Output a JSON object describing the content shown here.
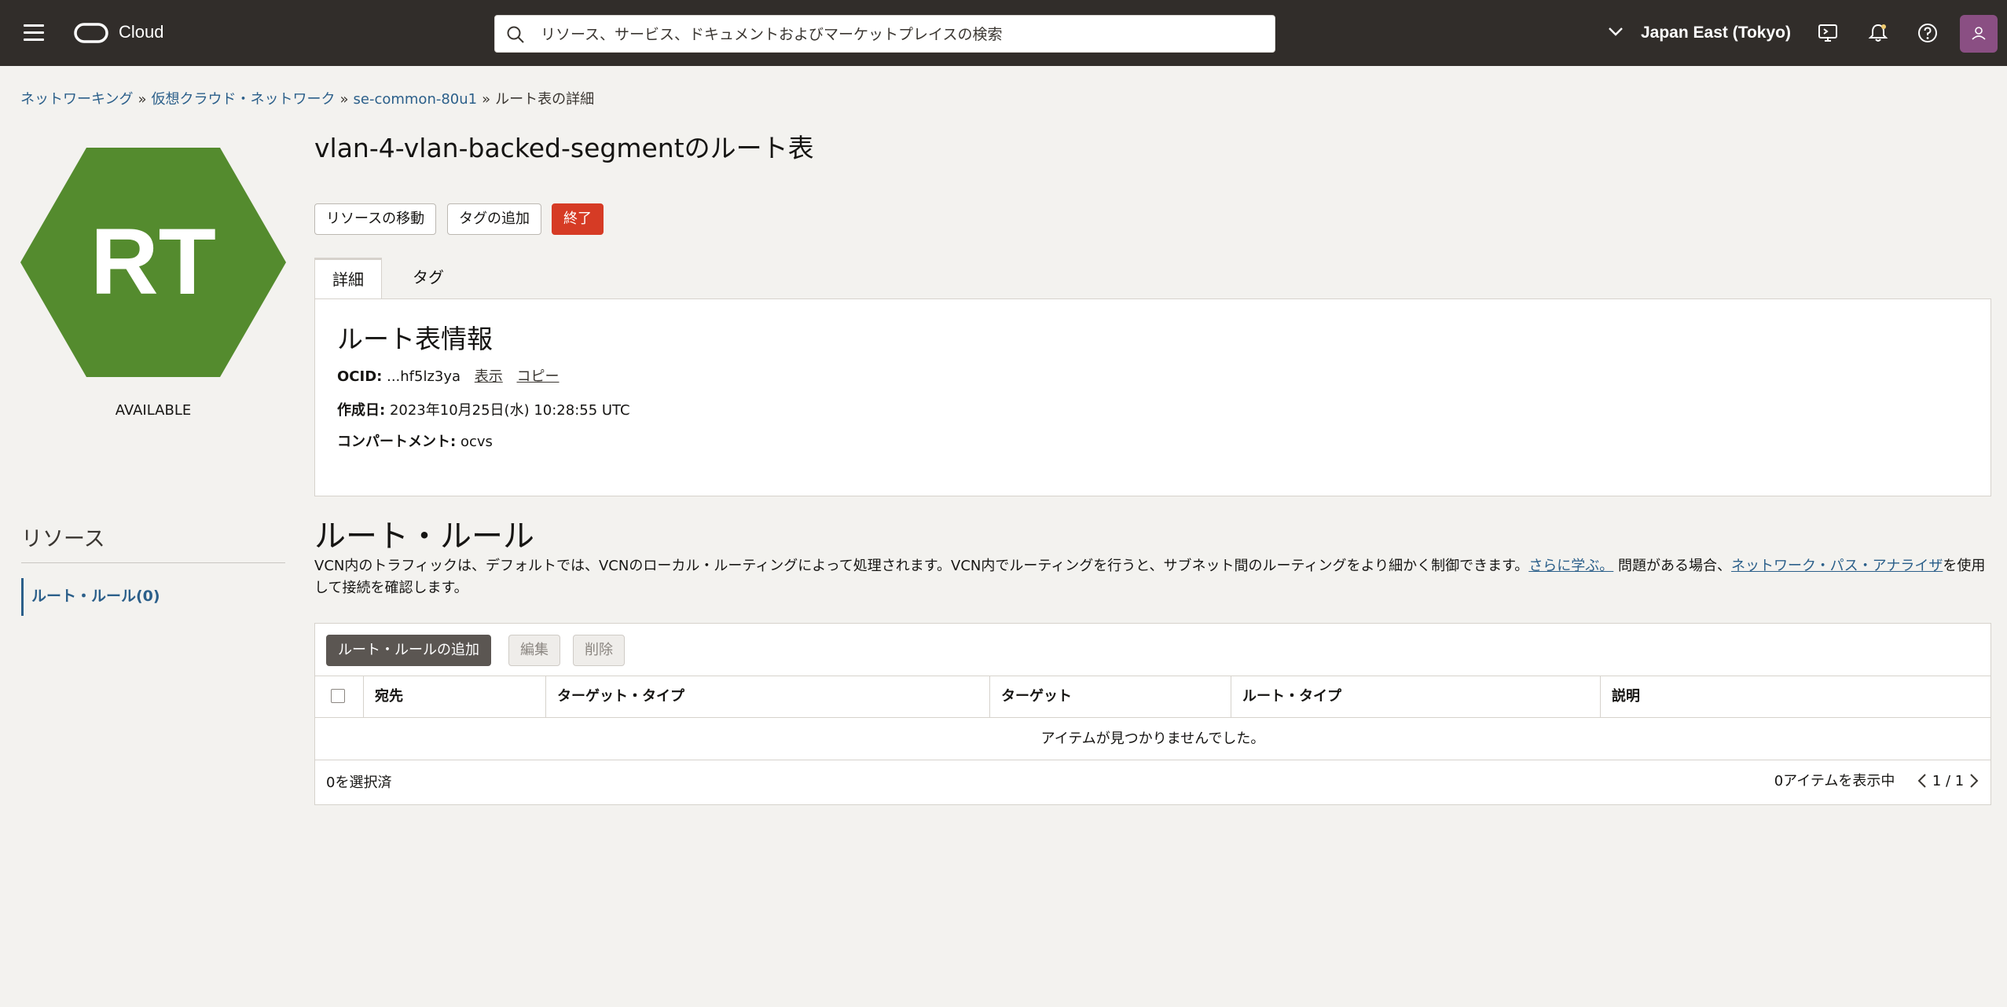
{
  "topbar": {
    "brand": "Cloud",
    "search_placeholder": "リソース、サービス、ドキュメントおよびマーケットプレイスの検索",
    "region": "Japan East (Tokyo)"
  },
  "breadcrumb": {
    "items": [
      "ネットワーキング",
      "仮想クラウド・ネットワーク",
      "se-common-80u1"
    ],
    "current": "ルート表の詳細",
    "separator": "»"
  },
  "resource_icon": {
    "text": "RT",
    "color": "#548b2e"
  },
  "status": "AVAILABLE",
  "resources": {
    "title": "リソース",
    "items": [
      "ルート・ルール(0)"
    ]
  },
  "page": {
    "title": "vlan-4-vlan-backed-segmentのルート表"
  },
  "actions": {
    "move": "リソースの移動",
    "add_tag": "タグの追加",
    "terminate": "終了"
  },
  "tabs": [
    "詳細",
    "タグ"
  ],
  "info": {
    "title": "ルート表情報",
    "ocid_label": "OCID:",
    "ocid_value": "...hf5lz3ya",
    "show": "表示",
    "copy": "コピー",
    "created_label": "作成日:",
    "created_value": "2023年10月25日(水) 10:28:55 UTC",
    "compartment_label": "コンパートメント:",
    "compartment_value": "ocvs"
  },
  "rules": {
    "title": "ルート・ルール",
    "desc_1": "VCN内のトラフィックは、デフォルトでは、VCNのローカル・ルーティングによって処理されます。VCN内でルーティングを行うと、サブネット間のルーティングをより細かく制御できます。",
    "learn_more": "さらに学ぶ。",
    "desc_2": " 問題がある場合、",
    "path_analyzer": "ネットワーク・パス・アナライザ",
    "desc_3": "を使用して接続を確認します。",
    "add_button": "ルート・ルールの追加",
    "edit_button": "編集",
    "delete_button": "削除",
    "columns": [
      "宛先",
      "ターゲット・タイプ",
      "ターゲット",
      "ルート・タイプ",
      "説明"
    ],
    "empty": "アイテムが見つかりませんでした。",
    "selected": "0を選択済",
    "showing": "0アイテムを表示中",
    "page": "1 / 1"
  },
  "colors": {
    "topbar": "#312d2a",
    "link": "#2b5f8a",
    "danger": "#d63b25"
  }
}
